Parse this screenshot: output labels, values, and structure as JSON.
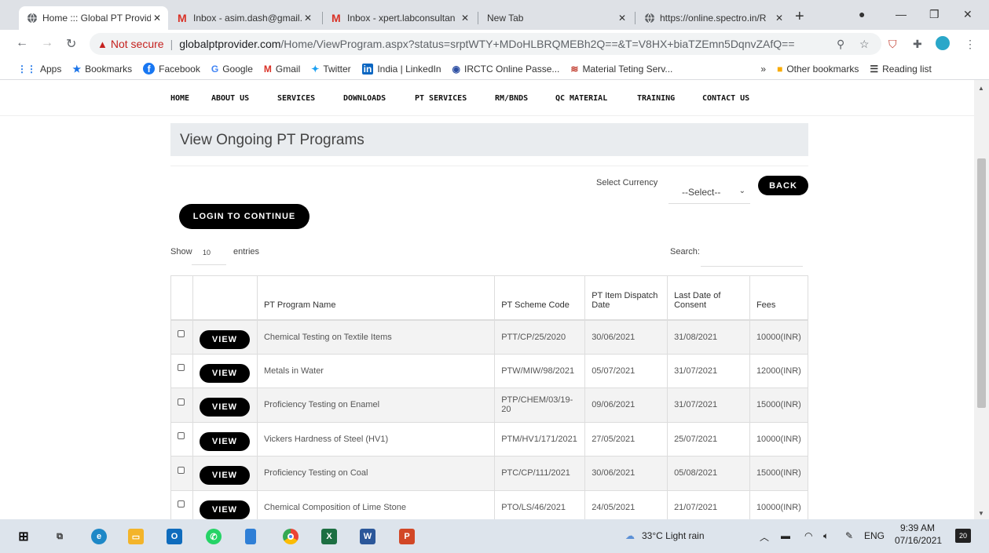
{
  "tabs": [
    {
      "title": "Home ::: Global PT Provide",
      "active": true
    },
    {
      "title": "Inbox - asim.dash@gmail.",
      "active": false
    },
    {
      "title": "Inbox - xpert.labconsultan",
      "active": false
    },
    {
      "title": "New Tab",
      "active": false
    },
    {
      "title": "https://online.spectro.in/R",
      "active": false
    }
  ],
  "address": {
    "security": "Not secure",
    "host": "globalptprovider.com",
    "path": "/Home/ViewProgram.aspx?status=srptWTY+MDoHLBRQMEBh2Q==&T=V8HX+biaTZEmn5DqnvZAfQ=="
  },
  "bookmarks": [
    "Apps",
    "Bookmarks",
    "Facebook",
    "Google",
    "Gmail",
    "Twitter",
    "India | LinkedIn",
    "IRCTC Online Passe...",
    "Material Teting Serv..."
  ],
  "bookmarks_right": {
    "more": "»",
    "other": "Other bookmarks",
    "reading": "Reading list"
  },
  "menu": [
    "HOME",
    "ABOUT US",
    "SERVICES",
    "DOWNLOADS",
    "PT SERVICES",
    "RM/BNDS",
    "QC MATERIAL",
    "TRAINING",
    "CONTACT US"
  ],
  "page": {
    "title": "View Ongoing PT Programs",
    "currency_label": "Select Currency",
    "currency_value": "--Select--",
    "back_label": "BACK",
    "login_label": "LOGIN TO CONTINUE",
    "show_label": "Show",
    "show_value": "10",
    "entries_label": "entries",
    "search_label": "Search:",
    "search_value": ""
  },
  "table": {
    "headers": [
      "",
      "",
      "PT Program Name",
      "PT Scheme Code",
      "PT Item Dispatch Date",
      "Last Date of Consent",
      "Fees"
    ],
    "view_label": "VIEW",
    "rows": [
      [
        "Chemical Testing on Textile Items",
        "PTT/CP/25/2020",
        "30/06/2021",
        "31/08/2021",
        "10000(INR)"
      ],
      [
        "Metals in Water",
        "PTW/MIW/98/2021",
        "05/07/2021",
        "31/07/2021",
        "12000(INR)"
      ],
      [
        "Proficiency Testing on Enamel",
        "PTP/CHEM/03/19-20",
        "09/06/2021",
        "31/07/2021",
        "15000(INR)"
      ],
      [
        "Vickers Hardness of Steel (HV1)",
        "PTM/HV1/171/2021",
        "27/05/2021",
        "25/07/2021",
        "10000(INR)"
      ],
      [
        "Proficiency Testing on Coal",
        "PTC/CP/111/2021",
        "30/06/2021",
        "05/08/2021",
        "15000(INR)"
      ],
      [
        "Chemical Composition of Lime Stone",
        "PTO/LS/46/2021",
        "24/05/2021",
        "21/07/2021",
        "10000(INR)"
      ]
    ]
  },
  "taskbar": {
    "weather": "33°C  Light rain",
    "lang": "ENG",
    "time": "9:39 AM",
    "date": "07/16/2021",
    "notif": "20"
  }
}
